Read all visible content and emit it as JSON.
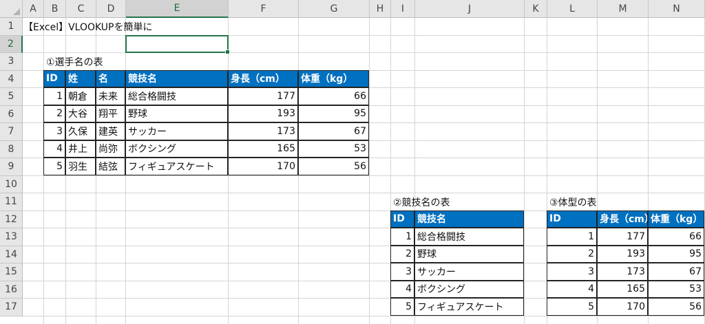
{
  "columns": [
    "A",
    "B",
    "C",
    "D",
    "E",
    "F",
    "G",
    "H",
    "I",
    "J",
    "K",
    "L",
    "M",
    "N"
  ],
  "rows": [
    "1",
    "2",
    "3",
    "4",
    "5",
    "6",
    "7",
    "8",
    "9",
    "10",
    "11",
    "12",
    "13",
    "14",
    "15",
    "16",
    "17"
  ],
  "selected_cell": {
    "col": "E",
    "row": "2"
  },
  "title": "【Excel】VLOOKUPを簡単に",
  "table1": {
    "caption": "①選手名の表",
    "headers": [
      "ID",
      "姓",
      "名",
      "競技名",
      "身長（cm）",
      "体重（kg）"
    ],
    "rows": [
      [
        "1",
        "朝倉",
        "未来",
        "総合格闘技",
        "177",
        "66"
      ],
      [
        "2",
        "大谷",
        "翔平",
        "野球",
        "193",
        "95"
      ],
      [
        "3",
        "久保",
        "建英",
        "サッカー",
        "173",
        "67"
      ],
      [
        "4",
        "井上",
        "尚弥",
        "ボクシング",
        "165",
        "53"
      ],
      [
        "5",
        "羽生",
        "結弦",
        "フィギュアスケート",
        "170",
        "56"
      ]
    ]
  },
  "table2": {
    "caption": "②競技名の表",
    "headers": [
      "ID",
      "競技名"
    ],
    "rows": [
      [
        "1",
        "総合格闘技"
      ],
      [
        "2",
        "野球"
      ],
      [
        "3",
        "サッカー"
      ],
      [
        "4",
        "ボクシング"
      ],
      [
        "5",
        "フィギュアスケート"
      ]
    ]
  },
  "table3": {
    "caption": "③体型の表",
    "headers": [
      "ID",
      "身長（cm）",
      "体重（kg）"
    ],
    "rows": [
      [
        "1",
        "177",
        "66"
      ],
      [
        "2",
        "193",
        "95"
      ],
      [
        "3",
        "173",
        "67"
      ],
      [
        "4",
        "165",
        "53"
      ],
      [
        "5",
        "170",
        "56"
      ]
    ]
  }
}
